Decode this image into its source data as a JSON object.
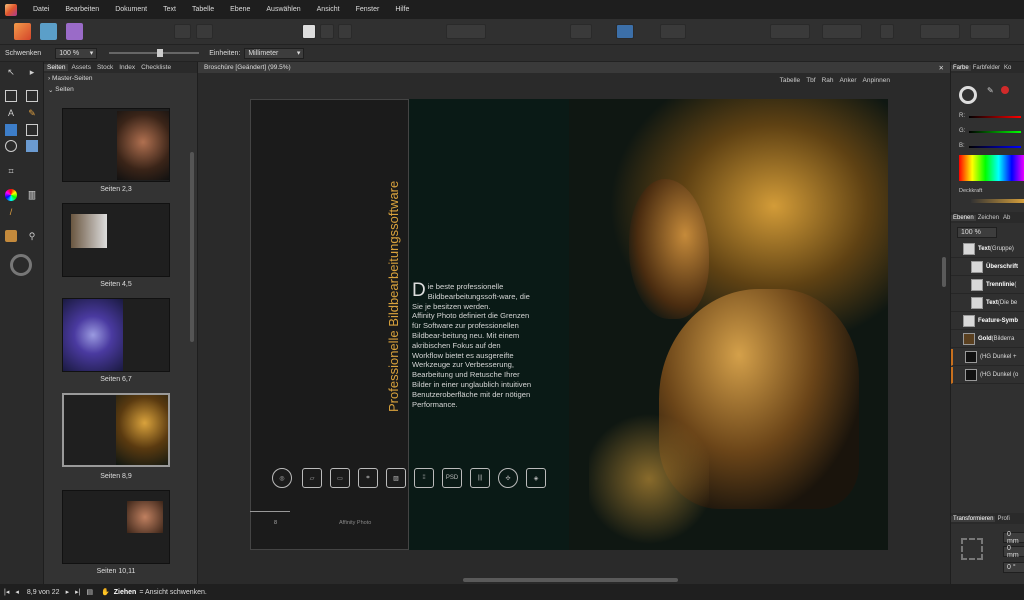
{
  "menu": [
    "Datei",
    "Bearbeiten",
    "Dokument",
    "Text",
    "Tabelle",
    "Ebene",
    "Auswählen",
    "Ansicht",
    "Fenster",
    "Hilfe"
  ],
  "context": {
    "tool_name": "Schwenken",
    "zoom_value": "100 %",
    "units_label": "Einheiten:",
    "units_value": "Millimeter"
  },
  "pages_panel": {
    "tabs": [
      "Seiten",
      "Assets",
      "Stock",
      "Index",
      "Checkliste"
    ],
    "master_label": "Master-Seiten",
    "pages_label": "Seiten",
    "thumbs": [
      "Seiten 2,3",
      "Seiten 4,5",
      "Seiten 6,7",
      "Seiten 8,9",
      "Seiten 10,11"
    ]
  },
  "document": {
    "tab_title": "Broschüre [Geändert] (99.5%)",
    "studio_tabs": [
      "Tabelle",
      "Tbf",
      "Rah",
      "Anker",
      "Anpinnen"
    ],
    "vertical_title": "Professionelle Bildbearbeitungssoftware",
    "dropcap": "D",
    "body_first": "ie beste professionelle Bildbearbeitungssoft-ware, die Sie je besitzen werden.",
    "body_second": "Affinity Photo definiert die Grenzen für Software zur professionellen Bildbear-beitung neu. Mit einem akribischen Fokus auf den Workflow bietet es ausgereifte Werkzeuge zur Verbesserung, Bearbeitung und Retusche Ihrer Bilder in einer unglaublich intuitiven Benutzeroberfläche mit der nötigen Performance.",
    "psd_label": "PSD",
    "page_number": "8",
    "footer_app": "Affinity Photo"
  },
  "right_panel": {
    "color_tabs": [
      "Farbe",
      "Farbfelder",
      "Ko"
    ],
    "sliders": [
      "R:",
      "G:",
      "B:"
    ],
    "opacity_label": "Deckkraft",
    "layers_tabs": [
      "Ebenen",
      "Zeichen",
      "Ab"
    ],
    "layer_opacity": "100 %",
    "layers": [
      {
        "name": "Text",
        "detail": " (Gruppe)"
      },
      {
        "name": "Überschrift",
        "detail": ""
      },
      {
        "name": "Trennlinie",
        "detail": " ("
      },
      {
        "name": "Text",
        "detail": " (Die be"
      },
      {
        "name": "Feature-Symb",
        "detail": ""
      },
      {
        "name": "Gold",
        "detail": " (Bilderra"
      },
      {
        "name": "",
        "detail": "(HG Dunkel +"
      },
      {
        "name": "",
        "detail": "(HG Dunkel (o"
      }
    ],
    "transform_tabs": [
      "Transformieren",
      "Profi"
    ],
    "transform_values": [
      "0 mm",
      "0 mm",
      "0 °"
    ]
  },
  "status": {
    "page_indicator": "8,9 von 22",
    "tool_bold": "Ziehen",
    "tool_hint": "= Ansicht schwenken."
  },
  "colors": {
    "accent": "#d9a23c",
    "background": "#2b2b2b"
  }
}
